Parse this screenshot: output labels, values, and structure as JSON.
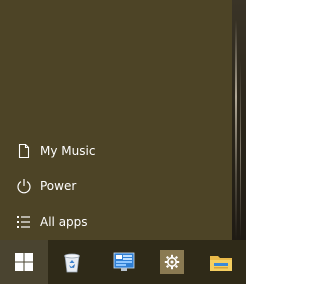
{
  "start_menu": {
    "items": [
      {
        "label": "My Music",
        "icon": "music-document-icon"
      },
      {
        "label": "Power",
        "icon": "power-icon"
      },
      {
        "label": "All apps",
        "icon": "list-icon"
      }
    ]
  },
  "taskbar": {
    "start_icon": "windows-logo-icon",
    "pinned": [
      {
        "icon": "recycle-bin-icon"
      },
      {
        "icon": "control-panel-icon"
      },
      {
        "icon": "gear-icon"
      },
      {
        "icon": "folder-icon"
      }
    ]
  },
  "colors": {
    "start_panel": "#4d4426",
    "taskbar": "#2f2a18",
    "start_button": "#4a4430",
    "settings_tile": "#8a7a52",
    "text": "#ffffff"
  }
}
